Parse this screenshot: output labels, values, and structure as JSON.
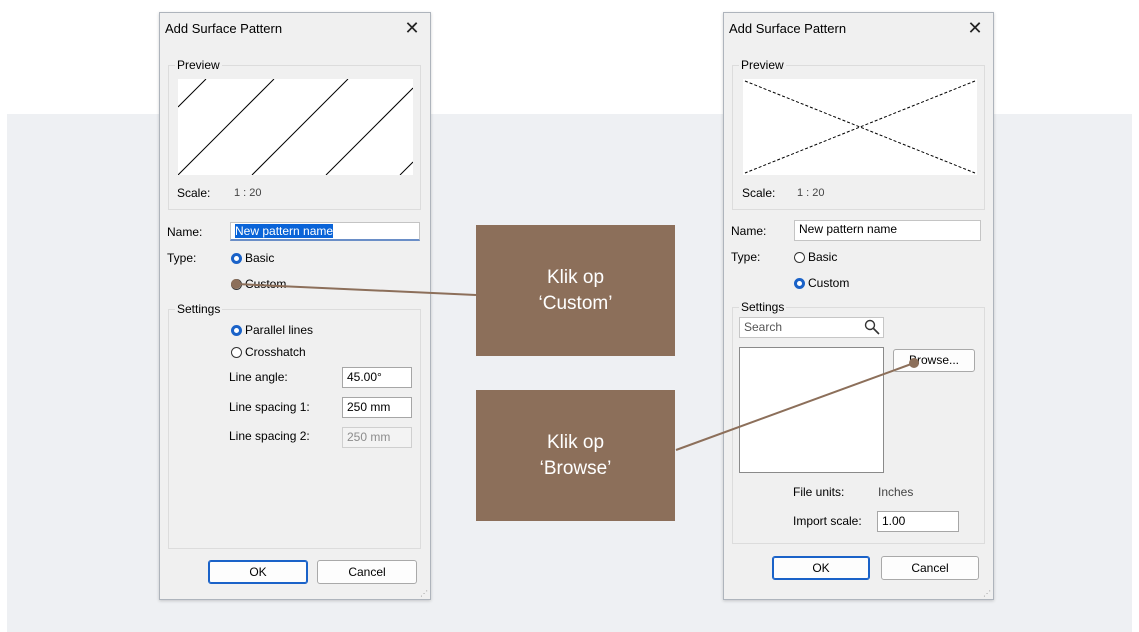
{
  "dialog_left": {
    "title": "Add Surface Pattern",
    "preview_label": "Preview",
    "scale_label": "Scale:",
    "scale_value": "1 : 20",
    "name_label": "Name:",
    "name_value": "New pattern name",
    "type_label": "Type:",
    "type_options": [
      "Basic",
      "Custom"
    ],
    "type_selected": "Basic",
    "settings_label": "Settings",
    "settings_options": [
      "Parallel lines",
      "Crosshatch"
    ],
    "settings_selected": "Parallel lines",
    "line_angle_label": "Line angle:",
    "line_angle_value": "45.00°",
    "line_spacing1_label": "Line spacing 1:",
    "line_spacing1_value": "250 mm",
    "line_spacing2_label": "Line spacing 2:",
    "line_spacing2_value": "250 mm",
    "ok_label": "OK",
    "cancel_label": "Cancel"
  },
  "dialog_right": {
    "title": "Add Surface Pattern",
    "preview_label": "Preview",
    "scale_label": "Scale:",
    "scale_value": "1 : 20",
    "name_label": "Name:",
    "name_value": "New pattern name",
    "type_label": "Type:",
    "type_options": [
      "Basic",
      "Custom"
    ],
    "type_selected": "Custom",
    "settings_label": "Settings",
    "search_placeholder": "Search",
    "browse_label": "Browse...",
    "file_units_label": "File units:",
    "file_units_value": "Inches",
    "import_scale_label": "Import scale:",
    "import_scale_value": "1.00",
    "ok_label": "OK",
    "cancel_label": "Cancel"
  },
  "callouts": {
    "custom": {
      "line1": "Klik op",
      "line2": "‘Custom’"
    },
    "browse": {
      "line1": "Klik op",
      "line2": "‘Browse’"
    }
  },
  "colors": {
    "callout_bg": "#8c6f5a",
    "connector": "#8c6f5a",
    "accent_blue": "#1a62c8",
    "backdrop": "#eef0f3"
  },
  "icons": {
    "close": "close-icon",
    "search": "search-icon",
    "resize_grip": "resize-grip-icon"
  }
}
